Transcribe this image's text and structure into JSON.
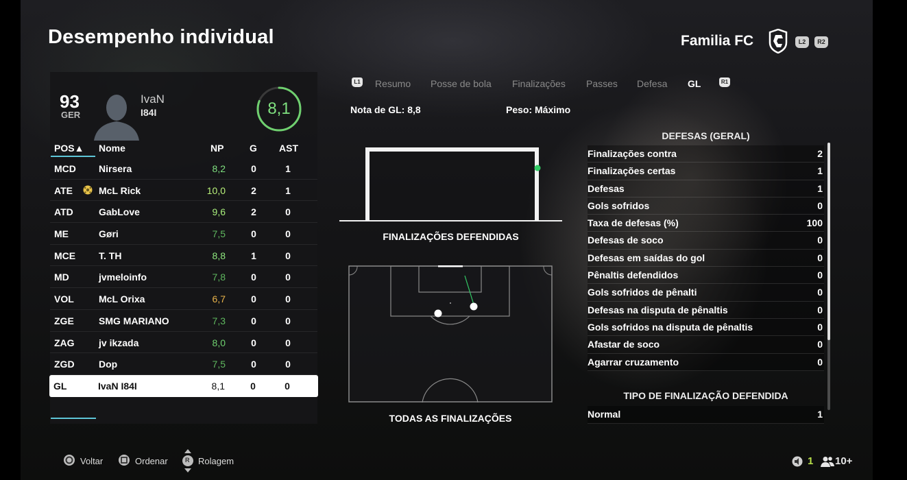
{
  "header": {
    "title": "Desempenho individual",
    "club_name": "Familia FC",
    "l2": "L2",
    "r2": "R2"
  },
  "player_card": {
    "overall": "93",
    "position": "GER",
    "name_line1": "IvaN",
    "name_line2": "I84I",
    "match_rating": "8,1"
  },
  "table": {
    "headers": {
      "pos": "POS▲",
      "name": "Nome",
      "np": "NP",
      "g": "G",
      "ast": "AST"
    },
    "rows": [
      {
        "pos": "MCD",
        "name": "Nirsera",
        "np": "8,2",
        "g": "0",
        "ast": "1",
        "color": "#7fe07f"
      },
      {
        "pos": "ATE",
        "name": "McL Rick",
        "np": "10,0",
        "g": "2",
        "ast": "1",
        "color": "#b8f07a",
        "motm": true
      },
      {
        "pos": "ATD",
        "name": "GabLove",
        "np": "9,6",
        "g": "2",
        "ast": "0",
        "color": "#a8ee7c"
      },
      {
        "pos": "ME",
        "name": "Gøri",
        "np": "7,5",
        "g": "0",
        "ast": "0",
        "color": "#5fb85f"
      },
      {
        "pos": "MCE",
        "name": "T. TH",
        "np": "8,8",
        "g": "1",
        "ast": "0",
        "color": "#8fe87f"
      },
      {
        "pos": "MD",
        "name": "jvmeloinfo",
        "np": "7,8",
        "g": "0",
        "ast": "0",
        "color": "#5fb85f"
      },
      {
        "pos": "VOL",
        "name": "McL Orixa",
        "np": "6,7",
        "g": "0",
        "ast": "0",
        "color": "#e8b34a"
      },
      {
        "pos": "ZGE",
        "name": "SMG MARIANO",
        "np": "7,3",
        "g": "0",
        "ast": "0",
        "color": "#5fb85f"
      },
      {
        "pos": "ZAG",
        "name": "jv ikzada",
        "np": "8,0",
        "g": "0",
        "ast": "0",
        "color": "#6fd06f"
      },
      {
        "pos": "ZGD",
        "name": "Dop",
        "np": "7,5",
        "g": "0",
        "ast": "0",
        "color": "#5fb85f"
      },
      {
        "pos": "GL",
        "name": "IvaN I84I",
        "np": "8,1",
        "g": "0",
        "ast": "0",
        "color": "#111111",
        "selected": true
      }
    ]
  },
  "tabs": {
    "l1": "L1",
    "r1": "R1",
    "items": [
      "Resumo",
      "Posse de bola",
      "Finalizações",
      "Passes",
      "Defesa",
      "GL"
    ],
    "active": "GL"
  },
  "gk_rating": "Nota de GL: 8,8",
  "weight": "Peso: Máximo",
  "goal_caption": "FINALIZAÇÕES DEFENDIDAS",
  "pitch_caption": "TODAS AS FINALIZAÇÕES",
  "stats": {
    "title": "DEFESAS (GERAL)",
    "items": [
      {
        "label": "Finalizações contra",
        "value": "2"
      },
      {
        "label": "Finalizações certas",
        "value": "1"
      },
      {
        "label": "Defesas",
        "value": "1"
      },
      {
        "label": "Gols sofridos",
        "value": "0"
      },
      {
        "label": "Taxa de defesas (%)",
        "value": "100"
      },
      {
        "label": "Defesas de soco",
        "value": "0"
      },
      {
        "label": "Defesas em saídas do gol",
        "value": "0"
      },
      {
        "label": "Pênaltis defendidos",
        "value": "0"
      },
      {
        "label": "Gols sofridos de pênalti",
        "value": "0"
      },
      {
        "label": "Defesas na disputa de pênaltis",
        "value": "0"
      },
      {
        "label": "Gols sofridos na disputa de pênaltis",
        "value": "0"
      },
      {
        "label": "Afastar de soco",
        "value": "0"
      },
      {
        "label": "Agarrar cruzamento",
        "value": "0"
      }
    ],
    "type_title": "TIPO DE FINALIZAÇÃO DEFENDIDA",
    "type_items": [
      {
        "label": "Normal",
        "value": "1"
      }
    ]
  },
  "footer": {
    "back": "Voltar",
    "sort": "Ordenar",
    "scroll": "Rolagem",
    "scroll_key": "R",
    "lobby_count": "1",
    "players": "10+"
  }
}
